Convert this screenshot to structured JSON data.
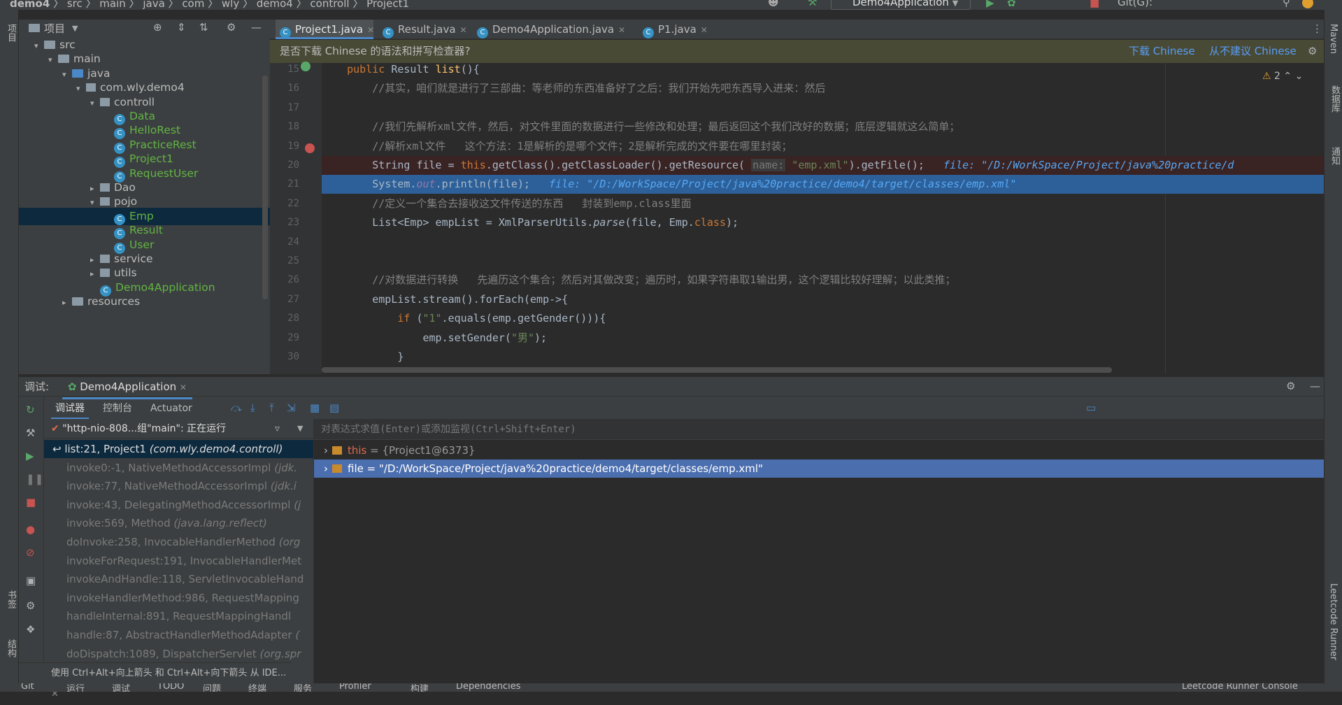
{
  "breadcrumb": [
    "demo4",
    "src",
    "main",
    "java",
    "com",
    "wly",
    "demo4",
    "controll",
    "Project1"
  ],
  "run_config": "Demo4Application",
  "git_label": "Git(G):",
  "left_strip": {
    "project": "项目",
    "bookmarks": "书签",
    "structure": "结构"
  },
  "right_strip": {
    "maven": "Maven",
    "database": "数据库",
    "notifications": "通知",
    "leetcode": "Leetcode Runner"
  },
  "project_panel": {
    "title": "项目",
    "tree": [
      {
        "label": "src",
        "type": "folder",
        "depth": 1,
        "expanded": true
      },
      {
        "label": "main",
        "type": "folder",
        "depth": 2,
        "expanded": true
      },
      {
        "label": "java",
        "type": "src",
        "depth": 3,
        "expanded": true
      },
      {
        "label": "com.wly.demo4",
        "type": "package",
        "depth": 4,
        "expanded": true
      },
      {
        "label": "controll",
        "type": "package",
        "depth": 5,
        "expanded": true
      },
      {
        "label": "Data",
        "type": "class",
        "depth": 6
      },
      {
        "label": "HelloRest",
        "type": "class",
        "depth": 6
      },
      {
        "label": "PracticeRest",
        "type": "class",
        "depth": 6
      },
      {
        "label": "Project1",
        "type": "class",
        "depth": 6
      },
      {
        "label": "RequestUser",
        "type": "class",
        "depth": 6
      },
      {
        "label": "Dao",
        "type": "package",
        "depth": 5,
        "expanded": false
      },
      {
        "label": "pojo",
        "type": "package",
        "depth": 5,
        "expanded": true
      },
      {
        "label": "Emp",
        "type": "class",
        "depth": 6,
        "selected": true
      },
      {
        "label": "Result",
        "type": "class",
        "depth": 6
      },
      {
        "label": "User",
        "type": "class",
        "depth": 6
      },
      {
        "label": "service",
        "type": "package",
        "depth": 5,
        "expanded": false
      },
      {
        "label": "utils",
        "type": "package",
        "depth": 5,
        "expanded": false
      },
      {
        "label": "Demo4Application",
        "type": "app",
        "depth": 5
      },
      {
        "label": "resources",
        "type": "folder",
        "depth": 3,
        "expanded": false
      }
    ]
  },
  "editor_tabs": [
    {
      "label": "Project1.java",
      "active": true
    },
    {
      "label": "Result.java",
      "active": false
    },
    {
      "label": "Demo4Application.java",
      "active": false
    },
    {
      "label": "P1.java",
      "active": false
    }
  ],
  "notice": {
    "text": "是否下载 Chinese 的语法和拼写检查器?",
    "download": "下载 Chinese",
    "never": "从不建议 Chinese",
    "warnings": "2"
  },
  "code_lines": [
    {
      "n": "15",
      "html": "    <span class=\"kw\">public</span> Result <span class=\"fn\">list</span>(){"
    },
    {
      "n": "16",
      "html": "        <span class=\"cm\">//其实，咱们就是进行了三部曲：等老师的东西准备好了之后：我们开始先吧东西导入进来：然后</span>"
    },
    {
      "n": "17",
      "html": ""
    },
    {
      "n": "18",
      "html": "        <span class=\"cm\">//我们先解析xml文件，然后，对文件里面的数据进行一些修改和处理；最后返回这个我们改好的数据；底层逻辑就这么简单；</span>"
    },
    {
      "n": "19",
      "html": "        <span class=\"cm\">//解析xml文件   这个方法：1是解析的是哪个文件；2是解析完成的文件要在哪里封装；</span>"
    },
    {
      "n": "20",
      "html": "        String file = <span class=\"kw\">this</span>.getClass().getClassLoader().getResource( <span class=\"hint\">name:</span> <span class=\"str\">\"emp.xml\"</span>).getFile();   <span class=\"dbgval\">file: \"/D:/WorkSpace/Project/java%20practice/d</span>",
      "bp": true
    },
    {
      "n": "21",
      "html": "        System.<span class=\"it\">out</span>.println(file);   <span class=\"dbgval\">file: \"/D:/WorkSpace/Project/java%20practice/demo4/target/classes/emp.xml\"</span>",
      "hl": true
    },
    {
      "n": "22",
      "html": "        <span class=\"cm\">//定义一个集合去接收这文件传送的东西   封装到emp.class里面</span>"
    },
    {
      "n": "23",
      "html": "        List&lt;Emp&gt; empList = XmlParserUtils.<span class=\"it\" style=\"color:#a9b7c6\">parse</span>(file, Emp.<span class=\"kw\">class</span>);"
    },
    {
      "n": "24",
      "html": ""
    },
    {
      "n": "25",
      "html": ""
    },
    {
      "n": "26",
      "html": "        <span class=\"cm\">//对数据进行转换   先遍历这个集合；然后对其做改变；遍历时，如果字符串取1输出男，这个逻辑比较好理解；以此类推；</span>"
    },
    {
      "n": "27",
      "html": "        empList.stream().forEach(emp-&gt;{"
    },
    {
      "n": "28",
      "html": "            <span class=\"kw\">if</span> (<span class=\"str\">\"1\"</span>.equals(emp.getGender())){"
    },
    {
      "n": "29",
      "html": "                emp.setGender(<span class=\"str\">\"男\"</span>);"
    },
    {
      "n": "30",
      "html": "            }"
    }
  ],
  "debug": {
    "title": "调试:",
    "session": "Demo4Application",
    "tabs": [
      "调试器",
      "控制台",
      "Actuator"
    ],
    "thread": "\"http-nio-808...组\"main\": 正在运行",
    "watch_placeholder": "对表达式求值(Enter)或添加监视(Ctrl+Shift+Enter)",
    "frames": [
      {
        "method": "list:21, Project1",
        "pkg": "(com.wly.demo4.controll)",
        "selected": true
      },
      {
        "method": "invoke0:-1, NativeMethodAccessorImpl",
        "pkg": "(jdk."
      },
      {
        "method": "invoke:77, NativeMethodAccessorImpl",
        "pkg": "(jdk.i"
      },
      {
        "method": "invoke:43, DelegatingMethodAccessorImpl",
        "pkg": "(j"
      },
      {
        "method": "invoke:569, Method",
        "pkg": "(java.lang.reflect)"
      },
      {
        "method": "doInvoke:258, InvocableHandlerMethod",
        "pkg": "(org"
      },
      {
        "method": "invokeForRequest:191, InvocableHandlerMet",
        "pkg": ""
      },
      {
        "method": "invokeAndHandle:118, ServletInvocableHand",
        "pkg": ""
      },
      {
        "method": "invokeHandlerMethod:986, RequestMapping",
        "pkg": ""
      },
      {
        "method": "handleInternal:891, RequestMappingHandl",
        "pkg": ""
      },
      {
        "method": "handle:87, AbstractHandlerMethodAdapter",
        "pkg": "("
      },
      {
        "method": "doDispatch:1089, DispatcherServlet",
        "pkg": "(org.spr"
      }
    ],
    "variables": [
      {
        "name": "this",
        "value": " = {Project1@6373}",
        "selected": false
      },
      {
        "name": "file",
        "value": " = \"/D:/WorkSpace/Project/java%20practice/demo4/target/classes/emp.xml\"",
        "selected": true
      }
    ],
    "status_hint": "使用 Ctrl+Alt+向上箭头 和 Ctrl+Alt+向下箭头 从 IDE..."
  },
  "bottom_tabs": [
    "Git",
    "运行",
    "调试",
    "TODO",
    "问题",
    "终端",
    "服务",
    "Profiler",
    "构建",
    "Dependencies",
    "Leetcode Runner Console"
  ],
  "colors": {
    "accent": "#4a88c7",
    "selection": "#2d6099",
    "green_class": "#62b543",
    "link": "#589df6"
  }
}
